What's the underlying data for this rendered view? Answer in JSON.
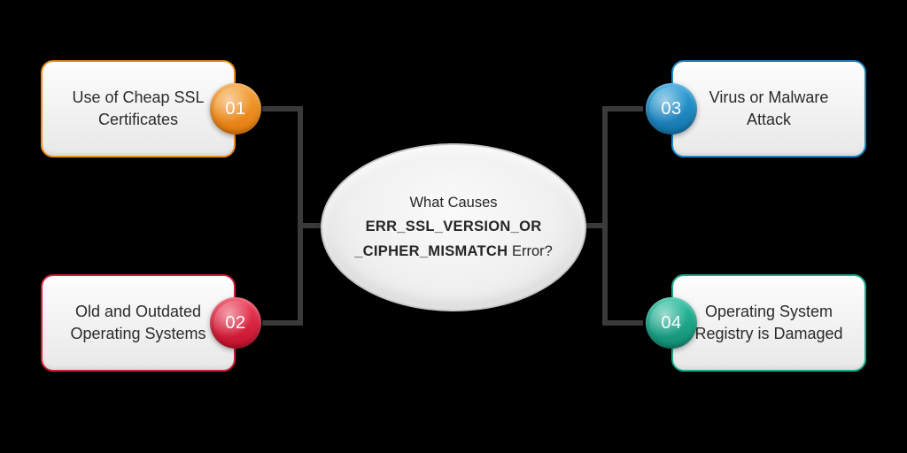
{
  "center": {
    "line1": "What Causes",
    "err1": "ERR_SSL_VERSION_OR",
    "err2": "_CIPHER_MISMATCH",
    "suffix": " Error?"
  },
  "causes": [
    {
      "num": "01",
      "text": "Use of Cheap SSL Certificates",
      "color": "#ed8b1b"
    },
    {
      "num": "02",
      "text": "Old and Outdated Operating Systems",
      "color": "#d31e3a"
    },
    {
      "num": "03",
      "text": "Virus or Malware Attack",
      "color": "#1d88c4"
    },
    {
      "num": "04",
      "text": "Operating System Registry is Damaged",
      "color": "#1ea98b"
    }
  ]
}
